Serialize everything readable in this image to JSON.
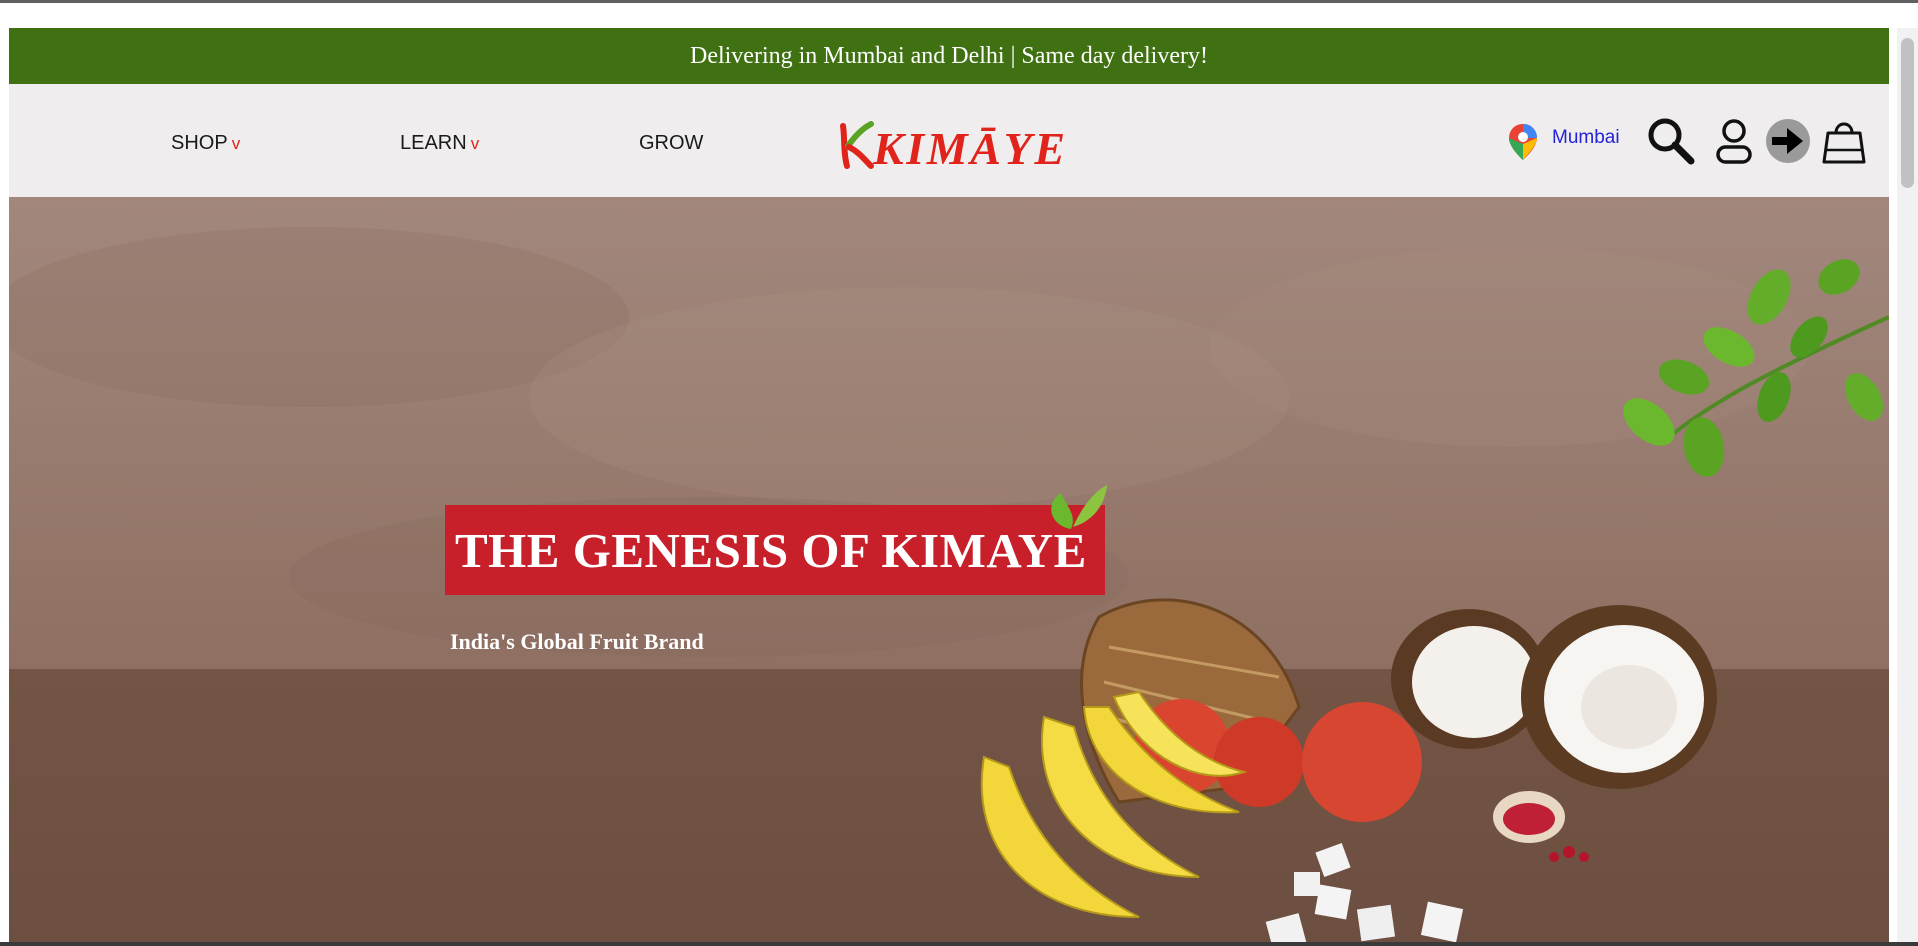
{
  "announcement": {
    "text": "Delivering in Mumbai and Delhi | Same day delivery!"
  },
  "nav": {
    "shop": {
      "label": "SHOP",
      "caret": "v"
    },
    "learn": {
      "label": "LEARN",
      "caret": "v"
    },
    "grow": {
      "label": "GROW"
    }
  },
  "brand": {
    "logo_text": "KIMĀYE"
  },
  "location": {
    "city": "Mumbai"
  },
  "icons": [
    "map-pin-icon",
    "search-icon",
    "user-icon",
    "login-arrow-icon",
    "shopping-bag-icon"
  ],
  "hero": {
    "title": "THE GENESIS OF KIMAYE",
    "subtitle": "India's Global Fruit Brand"
  },
  "colors": {
    "announcement_bg": "#3f7012",
    "header_bg": "#efedee",
    "brand_red": "#e0241b",
    "banner_red": "#c8202a",
    "location_link": "#2323d6",
    "leaf_green": "#5aa323"
  }
}
